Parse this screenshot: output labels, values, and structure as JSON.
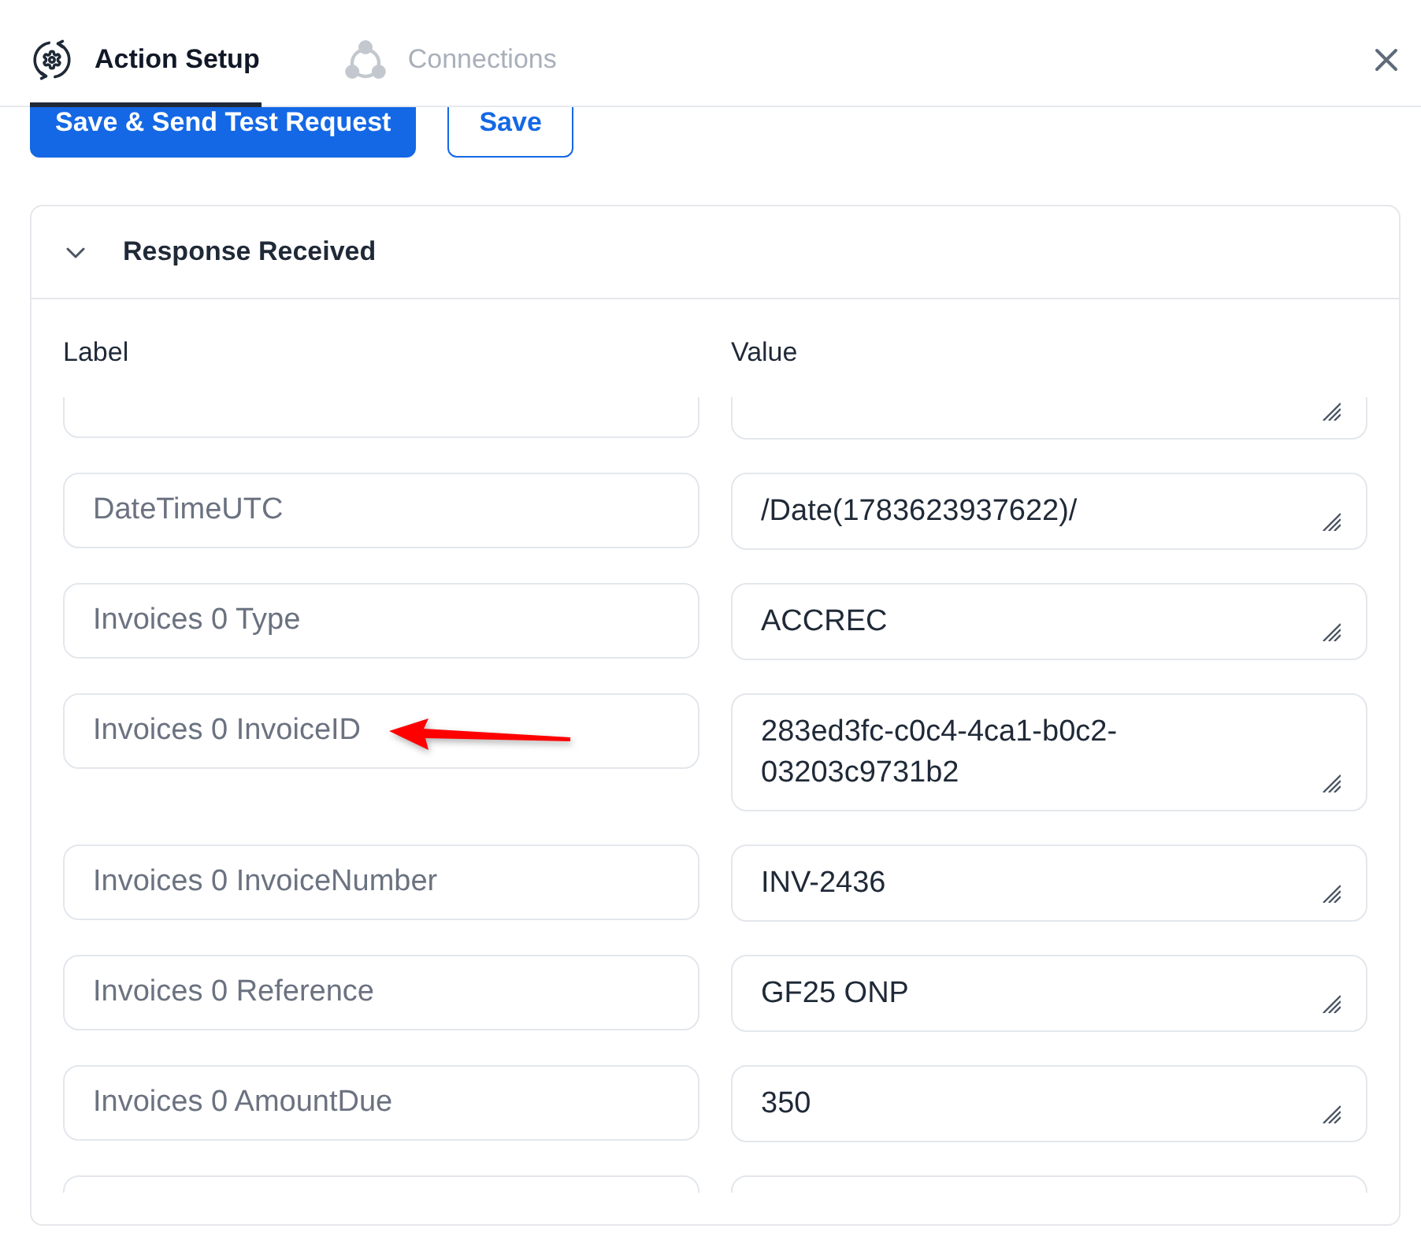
{
  "tabs": [
    {
      "label": "Action Setup",
      "kind": "setup",
      "selected": true
    },
    {
      "label": "Connections",
      "kind": "connections",
      "selected": false
    }
  ],
  "actions": [
    {
      "label": "Save & Send Test Request",
      "kind": "primary"
    },
    {
      "label": "Save",
      "kind": "outline"
    }
  ],
  "panel": {
    "title": "Response Received",
    "expanded": true,
    "columns": [
      "Label",
      "Value"
    ],
    "rows": [
      {
        "pointer_arrow": false
      },
      {
        "label": "DateTimeUTC",
        "value": "/Date(1783623937622)/",
        "pointer_arrow": false
      },
      {
        "label": "Invoices 0 Type",
        "value": "ACCREC",
        "pointer_arrow": false
      },
      {
        "label": "Invoices 0 InvoiceID",
        "value": "283ed3fc-c0c4-4ca1-b0c2-03203c9731b2",
        "pointer_arrow": true
      },
      {
        "label": "Invoices 0 InvoiceNumber",
        "value": "INV-2436",
        "pointer_arrow": false
      },
      {
        "label": "Invoices 0 Reference",
        "value": "GF25 ONP",
        "pointer_arrow": false
      },
      {
        "label": "Invoices 0 AmountDue",
        "value": "350",
        "pointer_arrow": false
      },
      {
        "pointer_arrow": false
      }
    ]
  }
}
